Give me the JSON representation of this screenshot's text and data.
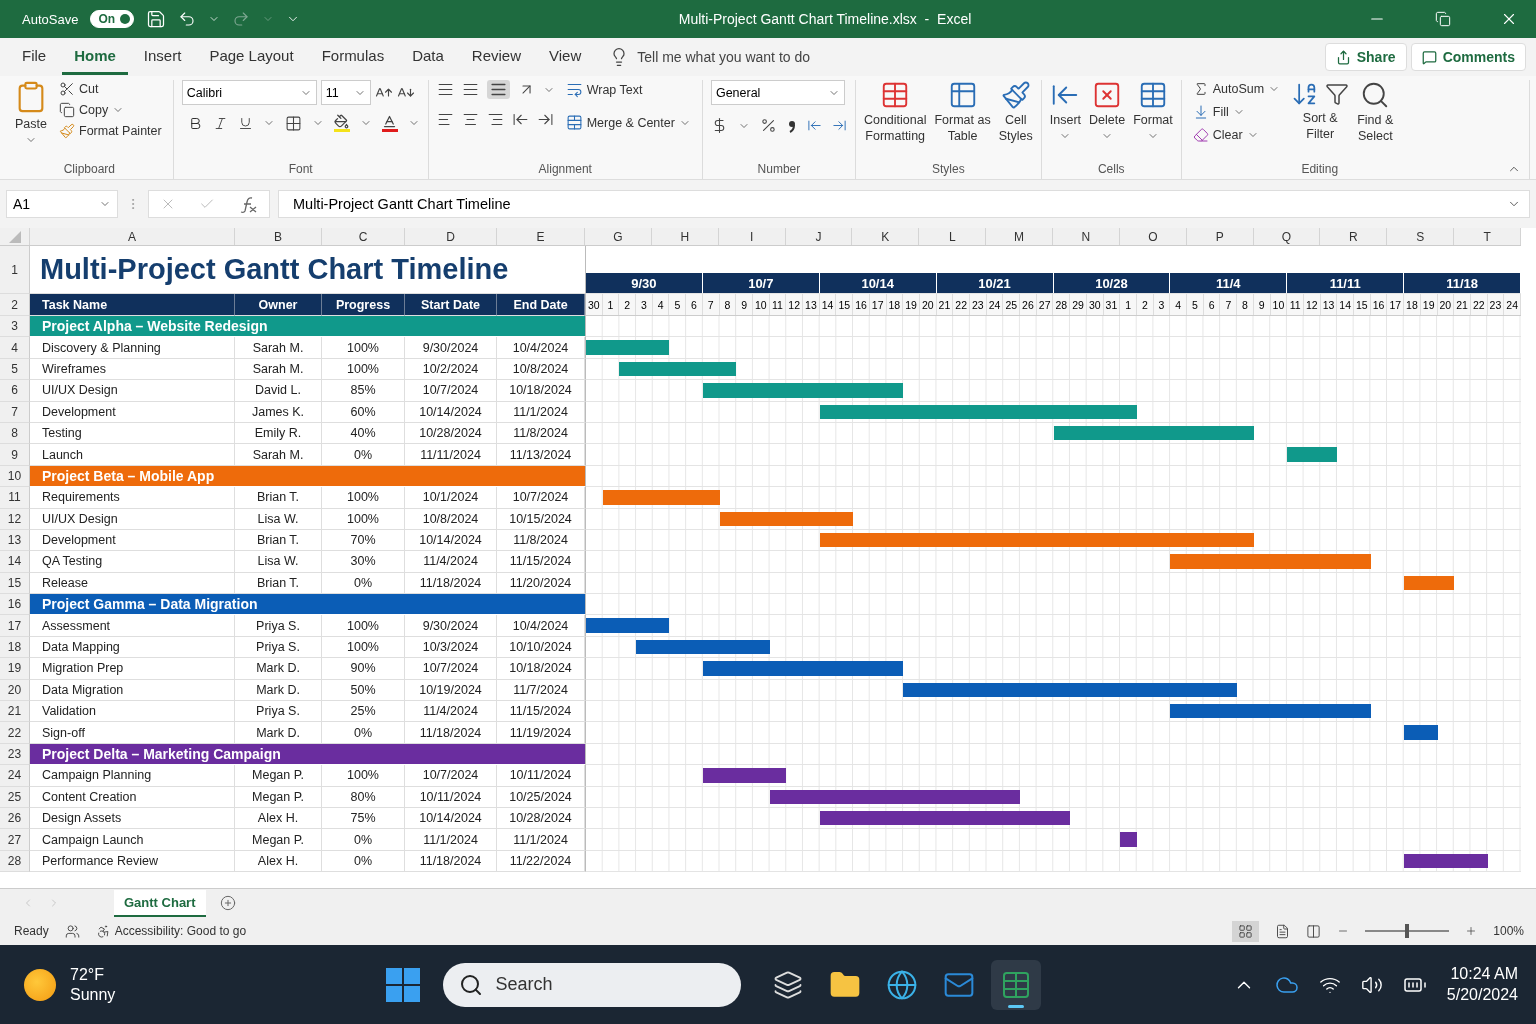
{
  "title_bar": {
    "autosave": {
      "label": "AutoSave",
      "state": "On",
      "on": true
    },
    "title": "Multi-Project Gantt Chart Timeline.xlsx  -  Excel"
  },
  "ribbon_tabs": [
    {
      "label": "File",
      "selected": false
    },
    {
      "label": "Home",
      "selected": true
    },
    {
      "label": "Insert",
      "selected": false
    },
    {
      "label": "Page Layout",
      "selected": false
    },
    {
      "label": "Formulas",
      "selected": false
    },
    {
      "label": "Data",
      "selected": false
    },
    {
      "label": "Review",
      "selected": false
    },
    {
      "label": "View",
      "selected": false
    }
  ],
  "tell_me": "Tell me what you want to do",
  "share": "Share",
  "comments": "Comments",
  "ribbon": {
    "clipboard": {
      "paste": "Paste",
      "cut": "Cut",
      "copy": "Copy",
      "format_painter": "Format Painter",
      "label": "Clipboard"
    },
    "font": {
      "name": "Calibri",
      "size": "11",
      "label": "Font"
    },
    "alignment": {
      "wrap": "Wrap Text",
      "merge": "Merge & Center",
      "label": "Alignment"
    },
    "number": {
      "format": "General",
      "label": "Number"
    },
    "styles": {
      "conditional": [
        "Conditional",
        "Formatting"
      ],
      "table": [
        "Format as",
        "Table"
      ],
      "cell": [
        "Cell",
        "Styles"
      ],
      "label": "Styles"
    },
    "cells": {
      "insert": "Insert",
      "delete": "Delete",
      "format": "Format",
      "label": "Cells"
    },
    "editing": {
      "autosum": "AutoSum",
      "fill": "Fill",
      "clear": "Clear",
      "sort": [
        "Sort &",
        "Filter"
      ],
      "find": [
        "Find &",
        "Select"
      ],
      "label": "Editing"
    }
  },
  "formula_bar": {
    "name_box": "A1",
    "formula": "Multi-Project Gantt Chart Timeline"
  },
  "sheet": {
    "columns": [
      "A",
      "B",
      "C",
      "D",
      "E"
    ],
    "gantt_columns": [
      "G",
      "H",
      "I",
      "J",
      "K",
      "L",
      "M",
      "N",
      "O",
      "P",
      "Q",
      "R",
      "S",
      "T"
    ],
    "row_numbers": [
      "1",
      "2",
      "3",
      "4",
      "5",
      "6",
      "7",
      "8",
      "9",
      "10",
      "11",
      "12",
      "13",
      "14",
      "15",
      "16",
      "17",
      "18",
      "19",
      "20",
      "21",
      "22",
      "23",
      "24",
      "25",
      "26",
      "27",
      "28"
    ],
    "title": "Multi-Project Gantt Chart Timeline",
    "headers": [
      "Task Name",
      "Owner",
      "Progress",
      "Start Date",
      "End Date"
    ],
    "weeks": [
      "9/30",
      "10/7",
      "10/14",
      "10/21",
      "10/28",
      "11/4",
      "11/11",
      "11/18"
    ],
    "days": [
      "30",
      "1",
      "2",
      "3",
      "4",
      "5",
      "6",
      "7",
      "8",
      "9",
      "10",
      "11",
      "12",
      "13",
      "14",
      "15",
      "16",
      "17",
      "18",
      "19",
      "20",
      "21",
      "22",
      "23",
      "24",
      "25",
      "26",
      "27",
      "28",
      "29",
      "30",
      "31",
      "1",
      "2",
      "3",
      "4",
      "5",
      "6",
      "7",
      "8",
      "9",
      "10",
      "11",
      "12",
      "13",
      "14",
      "15",
      "16",
      "17",
      "18",
      "19",
      "20",
      "21",
      "22",
      "23",
      "24"
    ],
    "projects": [
      {
        "name": "Project Alpha – Website Redesign",
        "color": "#10998b",
        "tasks": [
          {
            "task": "Discovery & Planning",
            "owner": "Sarah M.",
            "progress": "100%",
            "start": "9/30/2024",
            "end": "10/4/2024"
          },
          {
            "task": "Wireframes",
            "owner": "Sarah M.",
            "progress": "100%",
            "start": "10/2/2024",
            "end": "10/8/2024"
          },
          {
            "task": "UI/UX Design",
            "owner": "David L.",
            "progress": "85%",
            "start": "10/7/2024",
            "end": "10/18/2024"
          },
          {
            "task": "Development",
            "owner": "James K.",
            "progress": "60%",
            "start": "10/14/2024",
            "end": "11/1/2024"
          },
          {
            "task": "Testing",
            "owner": "Emily R.",
            "progress": "40%",
            "start": "10/28/2024",
            "end": "11/8/2024"
          },
          {
            "task": "Launch",
            "owner": "Sarah M.",
            "progress": "0%",
            "start": "11/11/2024",
            "end": "11/13/2024"
          }
        ]
      },
      {
        "name": "Project Beta – Mobile App",
        "color": "#ee6b0b",
        "tasks": [
          {
            "task": "Requirements",
            "owner": "Brian T.",
            "progress": "100%",
            "start": "10/1/2024",
            "end": "10/7/2024"
          },
          {
            "task": "UI/UX Design",
            "owner": "Lisa W.",
            "progress": "100%",
            "start": "10/8/2024",
            "end": "10/15/2024"
          },
          {
            "task": "Development",
            "owner": "Brian T.",
            "progress": "70%",
            "start": "10/14/2024",
            "end": "11/8/2024"
          },
          {
            "task": "QA Testing",
            "owner": "Lisa W.",
            "progress": "30%",
            "start": "11/4/2024",
            "end": "11/15/2024"
          },
          {
            "task": "Release",
            "owner": "Brian T.",
            "progress": "0%",
            "start": "11/18/2024",
            "end": "11/20/2024"
          }
        ]
      },
      {
        "name": "Project Gamma – Data Migration",
        "color": "#0b5db6",
        "tasks": [
          {
            "task": "Assessment",
            "owner": "Priya S.",
            "progress": "100%",
            "start": "9/30/2024",
            "end": "10/4/2024"
          },
          {
            "task": "Data Mapping",
            "owner": "Priya S.",
            "progress": "100%",
            "start": "10/3/2024",
            "end": "10/10/2024"
          },
          {
            "task": "Migration Prep",
            "owner": "Mark D.",
            "progress": "90%",
            "start": "10/7/2024",
            "end": "10/18/2024"
          },
          {
            "task": "Data Migration",
            "owner": "Mark D.",
            "progress": "50%",
            "start": "10/19/2024",
            "end": "11/7/2024"
          },
          {
            "task": "Validation",
            "owner": "Priya S.",
            "progress": "25%",
            "start": "11/4/2024",
            "end": "11/15/2024"
          },
          {
            "task": "Sign-off",
            "owner": "Mark D.",
            "progress": "0%",
            "start": "11/18/2024",
            "end": "11/19/2024"
          }
        ]
      },
      {
        "name": "Project Delta – Marketing Campaign",
        "color": "#6a2d9f",
        "tasks": [
          {
            "task": "Campaign Planning",
            "owner": "Megan P.",
            "progress": "100%",
            "start": "10/7/2024",
            "end": "10/11/2024"
          },
          {
            "task": "Content Creation",
            "owner": "Megan P.",
            "progress": "80%",
            "start": "10/11/2024",
            "end": "10/25/2024"
          },
          {
            "task": "Design Assets",
            "owner": "Alex H.",
            "progress": "75%",
            "start": "10/14/2024",
            "end": "10/28/2024"
          },
          {
            "task": "Campaign Launch",
            "owner": "Megan P.",
            "progress": "0%",
            "start": "11/1/2024",
            "end": "11/1/2024"
          },
          {
            "task": "Performance Review",
            "owner": "Alex H.",
            "progress": "0%",
            "start": "11/18/2024",
            "end": "11/22/2024"
          }
        ]
      }
    ]
  },
  "sheet_tabs": [
    {
      "label": "Gantt Chart",
      "selected": true
    }
  ],
  "status_bar": {
    "ready": "Ready",
    "accessibility": "Accessibility: Good to go",
    "zoom": "100%",
    "zoom_level": {
      "level": 0.5
    }
  },
  "taskbar": {
    "temperature": "72°F",
    "weather": "Sunny",
    "search": "Search",
    "time": "10:24 AM",
    "date": "5/20/2024"
  }
}
